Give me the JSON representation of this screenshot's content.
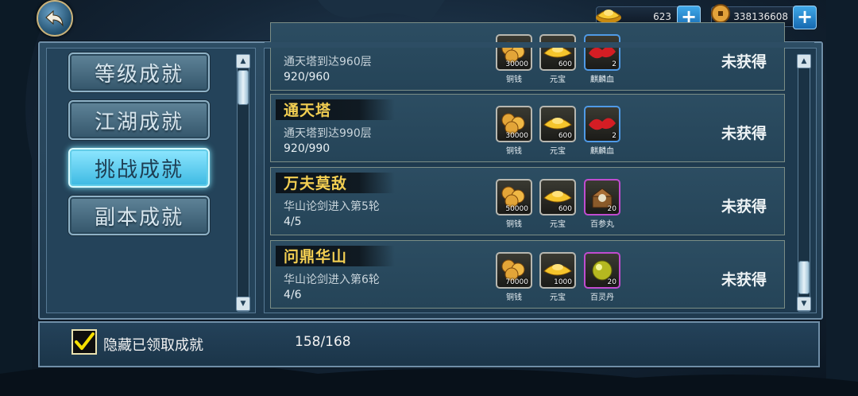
{
  "currencies": [
    {
      "name": "ingot",
      "icon": "gold-ingot-icon",
      "value": "623"
    },
    {
      "name": "copper",
      "icon": "copper-coin-icon",
      "value": "338136608"
    }
  ],
  "categories": [
    {
      "label": "等级成就",
      "active": false
    },
    {
      "label": "江湖成就",
      "active": false
    },
    {
      "label": "挑战成就",
      "active": true
    },
    {
      "label": "副本成就",
      "active": false
    }
  ],
  "achievements": [
    {
      "title": "",
      "desc": "通天塔到达960层",
      "progress": "920/960",
      "status": "未获得",
      "rewards": [
        {
          "icon": "copper-coins-icon",
          "qty": "30000",
          "name": "铜钱",
          "rarity": "white"
        },
        {
          "icon": "gold-ingot-icon",
          "qty": "600",
          "name": "元宝",
          "rarity": "white"
        },
        {
          "icon": "qilin-blood-icon",
          "qty": "2",
          "name": "麒麟血",
          "rarity": "blue"
        }
      ]
    },
    {
      "title": "通天塔",
      "desc": "通天塔到达990层",
      "progress": "920/990",
      "status": "未获得",
      "rewards": [
        {
          "icon": "copper-coins-icon",
          "qty": "30000",
          "name": "铜钱",
          "rarity": "white"
        },
        {
          "icon": "gold-ingot-icon",
          "qty": "600",
          "name": "元宝",
          "rarity": "white"
        },
        {
          "icon": "qilin-blood-icon",
          "qty": "2",
          "name": "麒麟血",
          "rarity": "blue"
        }
      ]
    },
    {
      "title": "万夫莫敌",
      "desc": "华山论剑进入第5轮",
      "progress": "4/5",
      "status": "未获得",
      "rewards": [
        {
          "icon": "copper-coins-icon",
          "qty": "50000",
          "name": "铜钱",
          "rarity": "white"
        },
        {
          "icon": "gold-ingot-icon",
          "qty": "600",
          "name": "元宝",
          "rarity": "white"
        },
        {
          "icon": "ginseng-pill-icon",
          "qty": "20",
          "name": "百参丸",
          "rarity": "purple"
        }
      ]
    },
    {
      "title": "问鼎华山",
      "desc": "华山论剑进入第6轮",
      "progress": "4/6",
      "status": "未获得",
      "rewards": [
        {
          "icon": "copper-coins-icon",
          "qty": "70000",
          "name": "铜钱",
          "rarity": "white"
        },
        {
          "icon": "gold-ingot-icon",
          "qty": "1000",
          "name": "元宝",
          "rarity": "white"
        },
        {
          "icon": "spirit-pill-icon",
          "qty": "20",
          "name": "百灵丹",
          "rarity": "purple"
        }
      ]
    }
  ],
  "footer": {
    "hide_claimed_label": "隐藏已领取成就",
    "hide_claimed_checked": true,
    "count": "158/168"
  }
}
